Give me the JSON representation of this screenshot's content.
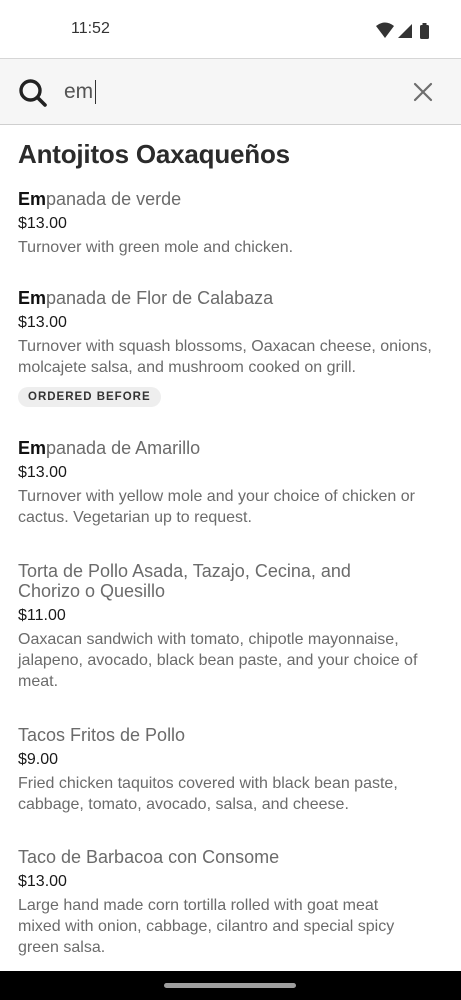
{
  "status_bar": {
    "time": "11:52",
    "icons": [
      "wifi-icon",
      "cellular-signal-icon",
      "battery-icon"
    ]
  },
  "search": {
    "query": "em",
    "icon": "search-icon",
    "clear_icon": "close-icon"
  },
  "section": {
    "title": "Antojitos Oaxaqueños"
  },
  "items": [
    {
      "match": "Em",
      "name_rest": "panada de verde",
      "price": "$13.00",
      "description": "Turnover with green mole and chicken."
    },
    {
      "match": "Em",
      "name_rest": "panada de Flor de Calabaza",
      "price": "$13.00",
      "description": "Turnover with squash blossoms, Oaxacan cheese, onions, molcajete salsa, and mushroom cooked on grill.",
      "badge": "ORDERED BEFORE"
    },
    {
      "match": "Em",
      "name_rest": "panada de Amarillo",
      "price": "$13.00",
      "description": "Turnover with yellow mole and your choice of chicken or cactus. Vegetarian up to request."
    },
    {
      "name": "Torta de Pollo Asada, Tazajo, Cecina, and Chorizo o Quesillo",
      "price": "$11.00",
      "description": "Oaxacan sandwich with tomato, chipotle mayonnaise, jalapeno, avocado, black bean paste, and your choice of meat."
    },
    {
      "name": "Tacos Fritos de Pollo",
      "price": "$9.00",
      "description": "Fried chicken taquitos covered with black bean paste, cabbage, tomato, avocado, salsa, and cheese."
    },
    {
      "name": "Taco de Barbacoa con Consome",
      "price": "$13.00",
      "description": "Large hand made corn tortilla  rolled with goat meat mixed with onion, cabbage, cilantro and special spicy green salsa."
    }
  ],
  "colors": {
    "search_bar_bg": "#f6f6f6",
    "text_primary": "#191919",
    "text_secondary": "#6b6b6b",
    "badge_bg": "#eeeeee",
    "nav_bar": "#000000"
  }
}
